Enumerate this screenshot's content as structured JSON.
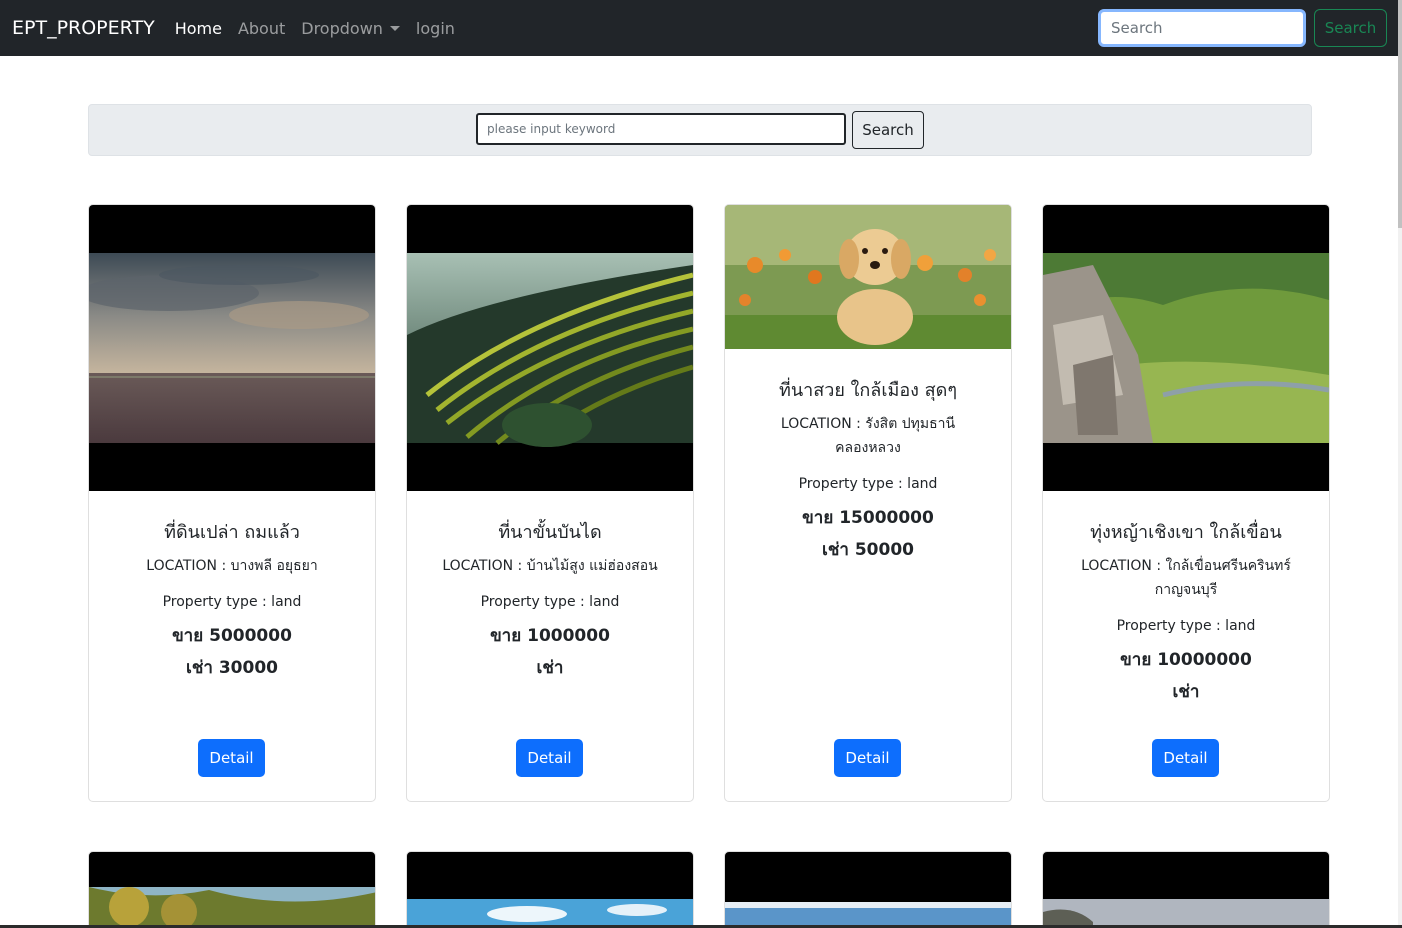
{
  "navbar": {
    "brand": "EPT_PROPERTY",
    "links": [
      "Home",
      "About",
      "Dropdown",
      "login"
    ],
    "search_placeholder": "Search",
    "search_button": "Search"
  },
  "keyword_search": {
    "placeholder": "please input keyword",
    "button": "Search"
  },
  "colors": {
    "navbar_bg": "#212529",
    "primary": "#0d6efd",
    "success": "#198754",
    "panel_bg": "#e9ecef"
  },
  "listings": [
    {
      "title": "ที่ดินเปล่า ถมแล้ว",
      "location": "LOCATION : บางพลี อยุธยา",
      "type": "Property type : land",
      "sale": "ขาย 5000000",
      "rent": "เช่า 30000",
      "detail": "Detail"
    },
    {
      "title": "ที่นาขั้นบันได",
      "location": "LOCATION : บ้านไม้สูง แม่ฮ่องสอน",
      "type": "Property type : land",
      "sale": "ขาย 1000000",
      "rent": "เช่า",
      "detail": "Detail"
    },
    {
      "title": "ที่นาสวย ใกล้เมือง สุดๆ",
      "location": "LOCATION : รังสิต ปทุมธานี คลองหลวง",
      "type": "Property type : land",
      "sale": "ขาย 15000000",
      "rent": "เช่า 50000",
      "detail": "Detail"
    },
    {
      "title": "ทุ่งหญ้าเชิงเขา ใกล้เขื่อน",
      "location": "LOCATION : ใกล้เขื่อนศรีนครินทร์ กาญจนบุรี",
      "type": "Property type : land",
      "sale": "ขาย 10000000",
      "rent": "เช่า",
      "detail": "Detail"
    }
  ]
}
